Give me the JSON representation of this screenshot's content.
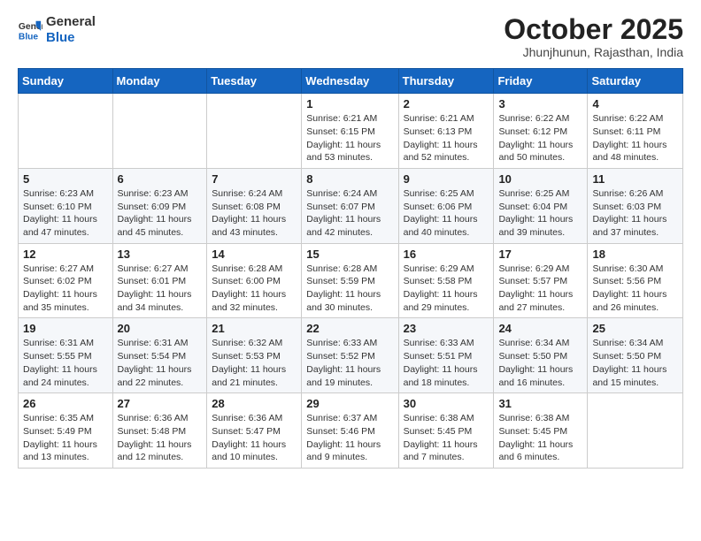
{
  "header": {
    "logo_general": "General",
    "logo_blue": "Blue",
    "month_title": "October 2025",
    "subtitle": "Jhunjhunun, Rajasthan, India"
  },
  "days_of_week": [
    "Sunday",
    "Monday",
    "Tuesday",
    "Wednesday",
    "Thursday",
    "Friday",
    "Saturday"
  ],
  "weeks": [
    [
      {
        "day": "",
        "info": ""
      },
      {
        "day": "",
        "info": ""
      },
      {
        "day": "",
        "info": ""
      },
      {
        "day": "1",
        "info": "Sunrise: 6:21 AM\nSunset: 6:15 PM\nDaylight: 11 hours and 53 minutes."
      },
      {
        "day": "2",
        "info": "Sunrise: 6:21 AM\nSunset: 6:13 PM\nDaylight: 11 hours and 52 minutes."
      },
      {
        "day": "3",
        "info": "Sunrise: 6:22 AM\nSunset: 6:12 PM\nDaylight: 11 hours and 50 minutes."
      },
      {
        "day": "4",
        "info": "Sunrise: 6:22 AM\nSunset: 6:11 PM\nDaylight: 11 hours and 48 minutes."
      }
    ],
    [
      {
        "day": "5",
        "info": "Sunrise: 6:23 AM\nSunset: 6:10 PM\nDaylight: 11 hours and 47 minutes."
      },
      {
        "day": "6",
        "info": "Sunrise: 6:23 AM\nSunset: 6:09 PM\nDaylight: 11 hours and 45 minutes."
      },
      {
        "day": "7",
        "info": "Sunrise: 6:24 AM\nSunset: 6:08 PM\nDaylight: 11 hours and 43 minutes."
      },
      {
        "day": "8",
        "info": "Sunrise: 6:24 AM\nSunset: 6:07 PM\nDaylight: 11 hours and 42 minutes."
      },
      {
        "day": "9",
        "info": "Sunrise: 6:25 AM\nSunset: 6:06 PM\nDaylight: 11 hours and 40 minutes."
      },
      {
        "day": "10",
        "info": "Sunrise: 6:25 AM\nSunset: 6:04 PM\nDaylight: 11 hours and 39 minutes."
      },
      {
        "day": "11",
        "info": "Sunrise: 6:26 AM\nSunset: 6:03 PM\nDaylight: 11 hours and 37 minutes."
      }
    ],
    [
      {
        "day": "12",
        "info": "Sunrise: 6:27 AM\nSunset: 6:02 PM\nDaylight: 11 hours and 35 minutes."
      },
      {
        "day": "13",
        "info": "Sunrise: 6:27 AM\nSunset: 6:01 PM\nDaylight: 11 hours and 34 minutes."
      },
      {
        "day": "14",
        "info": "Sunrise: 6:28 AM\nSunset: 6:00 PM\nDaylight: 11 hours and 32 minutes."
      },
      {
        "day": "15",
        "info": "Sunrise: 6:28 AM\nSunset: 5:59 PM\nDaylight: 11 hours and 30 minutes."
      },
      {
        "day": "16",
        "info": "Sunrise: 6:29 AM\nSunset: 5:58 PM\nDaylight: 11 hours and 29 minutes."
      },
      {
        "day": "17",
        "info": "Sunrise: 6:29 AM\nSunset: 5:57 PM\nDaylight: 11 hours and 27 minutes."
      },
      {
        "day": "18",
        "info": "Sunrise: 6:30 AM\nSunset: 5:56 PM\nDaylight: 11 hours and 26 minutes."
      }
    ],
    [
      {
        "day": "19",
        "info": "Sunrise: 6:31 AM\nSunset: 5:55 PM\nDaylight: 11 hours and 24 minutes."
      },
      {
        "day": "20",
        "info": "Sunrise: 6:31 AM\nSunset: 5:54 PM\nDaylight: 11 hours and 22 minutes."
      },
      {
        "day": "21",
        "info": "Sunrise: 6:32 AM\nSunset: 5:53 PM\nDaylight: 11 hours and 21 minutes."
      },
      {
        "day": "22",
        "info": "Sunrise: 6:33 AM\nSunset: 5:52 PM\nDaylight: 11 hours and 19 minutes."
      },
      {
        "day": "23",
        "info": "Sunrise: 6:33 AM\nSunset: 5:51 PM\nDaylight: 11 hours and 18 minutes."
      },
      {
        "day": "24",
        "info": "Sunrise: 6:34 AM\nSunset: 5:50 PM\nDaylight: 11 hours and 16 minutes."
      },
      {
        "day": "25",
        "info": "Sunrise: 6:34 AM\nSunset: 5:50 PM\nDaylight: 11 hours and 15 minutes."
      }
    ],
    [
      {
        "day": "26",
        "info": "Sunrise: 6:35 AM\nSunset: 5:49 PM\nDaylight: 11 hours and 13 minutes."
      },
      {
        "day": "27",
        "info": "Sunrise: 6:36 AM\nSunset: 5:48 PM\nDaylight: 11 hours and 12 minutes."
      },
      {
        "day": "28",
        "info": "Sunrise: 6:36 AM\nSunset: 5:47 PM\nDaylight: 11 hours and 10 minutes."
      },
      {
        "day": "29",
        "info": "Sunrise: 6:37 AM\nSunset: 5:46 PM\nDaylight: 11 hours and 9 minutes."
      },
      {
        "day": "30",
        "info": "Sunrise: 6:38 AM\nSunset: 5:45 PM\nDaylight: 11 hours and 7 minutes."
      },
      {
        "day": "31",
        "info": "Sunrise: 6:38 AM\nSunset: 5:45 PM\nDaylight: 11 hours and 6 minutes."
      },
      {
        "day": "",
        "info": ""
      }
    ]
  ]
}
